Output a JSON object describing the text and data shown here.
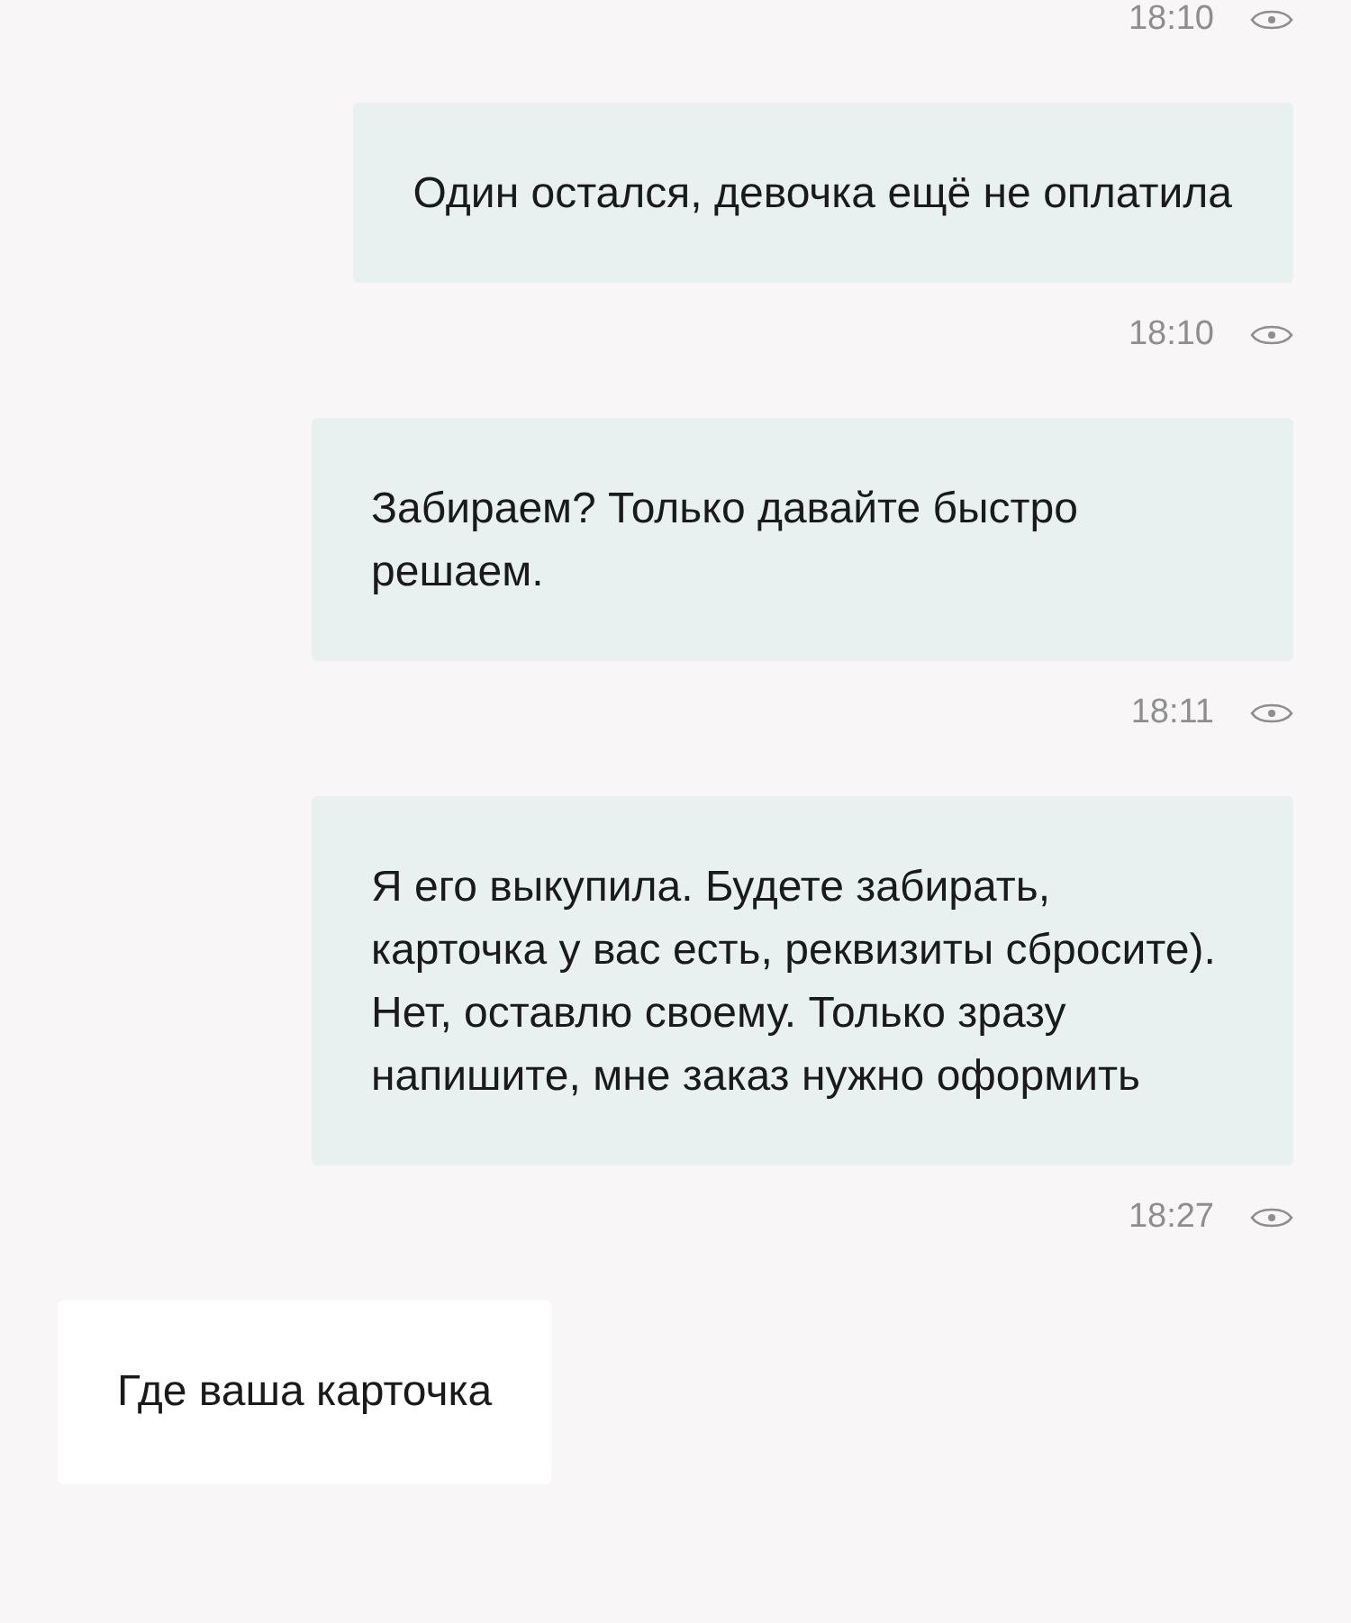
{
  "chat": [
    {
      "kind": "status",
      "time": "18:10",
      "seen": true
    },
    {
      "kind": "outgoing",
      "text": "Один остался, девочка ещё не оплатила"
    },
    {
      "kind": "status",
      "time": "18:10",
      "seen": true
    },
    {
      "kind": "outgoing",
      "text": "Забираем? Только давайте быстро решаем."
    },
    {
      "kind": "status",
      "time": "18:11",
      "seen": true
    },
    {
      "kind": "outgoing",
      "text": "Я его выкупила. Будете забирать, карточка у вас есть, реквизиты сбросите). Нет, оставлю своему. Только зразу напишите, мне заказ нужно оформить"
    },
    {
      "kind": "status",
      "time": "18:27",
      "seen": true
    },
    {
      "kind": "incoming",
      "text": "Где ваша карточка"
    }
  ]
}
